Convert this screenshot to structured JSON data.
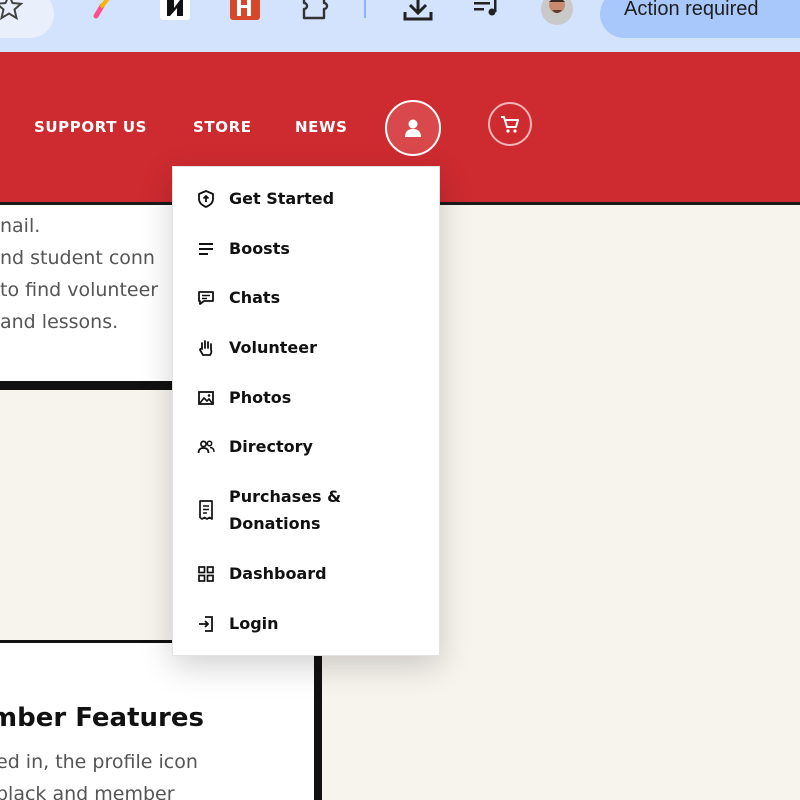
{
  "browser": {
    "action_button_label": "Action required",
    "icons": [
      "star-icon",
      "pen-icon",
      "extension-icon",
      "extension-icon",
      "puzzle-icon",
      "download-icon",
      "media-queue-icon",
      "profile-avatar"
    ]
  },
  "header": {
    "background_color": "#cd2b30",
    "nav": [
      {
        "label": "SUPPORT US"
      },
      {
        "label": "STORE"
      },
      {
        "label": "NEWS"
      }
    ],
    "icons": [
      "profile-icon",
      "cart-icon"
    ]
  },
  "page": {
    "intro_lines": [
      "nail.",
      "nd student conn",
      "to find volunteer",
      "and lessons."
    ],
    "features_title": "mber Features",
    "features_lines": [
      "ed in, the profile icon",
      "black and member"
    ]
  },
  "menu": {
    "items": [
      {
        "label": "Get Started",
        "icon": "shield-arrow-icon"
      },
      {
        "label": "Boosts",
        "icon": "lines-icon"
      },
      {
        "label": "Chats",
        "icon": "chat-icon"
      },
      {
        "label": "Volunteer",
        "icon": "hand-icon"
      },
      {
        "label": "Photos",
        "icon": "image-icon"
      },
      {
        "label": "Directory",
        "icon": "people-icon"
      },
      {
        "label_line1": "Purchases &",
        "label_line2": "Donations",
        "icon": "receipt-icon"
      },
      {
        "label": "Dashboard",
        "icon": "grid-icon"
      },
      {
        "label": "Login",
        "icon": "login-icon"
      }
    ]
  }
}
